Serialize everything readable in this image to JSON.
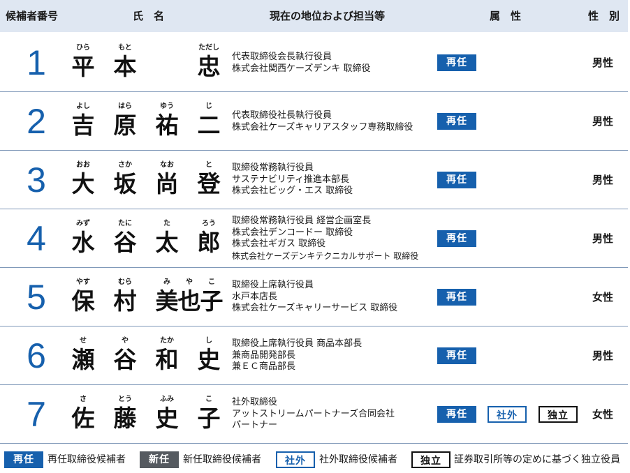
{
  "header": {
    "number": "候補者番号",
    "name": "氏　名",
    "position": "現在の地位および担当等",
    "attribute": "属　性",
    "gender": "性　別"
  },
  "candidates": [
    {
      "number": "1",
      "name": [
        {
          "ruby": "ひら",
          "kanji": "平"
        },
        {
          "ruby": "もと",
          "kanji": "本"
        },
        {
          "ruby": "ただし",
          "kanji": "忠"
        }
      ],
      "position": [
        "代表取締役会長執行役員",
        "株式会社関西ケーズデンキ 取締役"
      ],
      "badges": [
        "再任"
      ],
      "gender": "男性"
    },
    {
      "number": "2",
      "name": [
        {
          "ruby": "よし",
          "kanji": "吉"
        },
        {
          "ruby": "はら",
          "kanji": "原"
        },
        {
          "ruby": "ゆう",
          "kanji": "祐"
        },
        {
          "ruby": "じ",
          "kanji": "二"
        }
      ],
      "position": [
        "代表取締役社長執行役員",
        "株式会社ケーズキャリアスタッフ専務取締役"
      ],
      "badges": [
        "再任"
      ],
      "gender": "男性"
    },
    {
      "number": "3",
      "name": [
        {
          "ruby": "おお",
          "kanji": "大"
        },
        {
          "ruby": "さか",
          "kanji": "坂"
        },
        {
          "ruby": "なお",
          "kanji": "尚"
        },
        {
          "ruby": "と",
          "kanji": "登"
        }
      ],
      "position": [
        "取締役常務執行役員",
        "サステナビリティ推進本部長",
        "株式会社ビッグ・エス 取締役"
      ],
      "badges": [
        "再任"
      ],
      "gender": "男性"
    },
    {
      "number": "4",
      "name": [
        {
          "ruby": "みず",
          "kanji": "水"
        },
        {
          "ruby": "たに",
          "kanji": "谷"
        },
        {
          "ruby": "た",
          "kanji": "太"
        },
        {
          "ruby": "ろう",
          "kanji": "郎"
        }
      ],
      "position": [
        "取締役常務執行役員 経営企画室長",
        "株式会社デンコードー 取締役",
        "株式会社ギガス 取締役",
        "株式会社ケーズデンキテクニカルサポート 取締役"
      ],
      "badges": [
        "再任"
      ],
      "gender": "男性"
    },
    {
      "number": "5",
      "name": [
        {
          "ruby": "やす",
          "kanji": "保"
        },
        {
          "ruby": "むら",
          "kanji": "村"
        },
        {
          "ruby": "み",
          "kanji": "美"
        },
        {
          "ruby": "や",
          "kanji": "也"
        },
        {
          "ruby": "こ",
          "kanji": "子"
        }
      ],
      "position": [
        "取締役上席執行役員",
        "水戸本店長",
        "株式会社ケーズキャリーサービス 取締役"
      ],
      "badges": [
        "再任"
      ],
      "gender": "女性"
    },
    {
      "number": "6",
      "name": [
        {
          "ruby": "せ",
          "kanji": "瀬"
        },
        {
          "ruby": "や",
          "kanji": "谷"
        },
        {
          "ruby": "たか",
          "kanji": "和"
        },
        {
          "ruby": "し",
          "kanji": "史"
        }
      ],
      "position": [
        "取締役上席執行役員 商品本部長",
        "兼商品開発部長",
        "兼ＥＣ商品部長"
      ],
      "badges": [
        "再任"
      ],
      "gender": "男性"
    },
    {
      "number": "7",
      "name": [
        {
          "ruby": "さ",
          "kanji": "佐"
        },
        {
          "ruby": "とう",
          "kanji": "藤"
        },
        {
          "ruby": "ふみ",
          "kanji": "史"
        },
        {
          "ruby": "こ",
          "kanji": "子"
        }
      ],
      "position": [
        "社外取締役",
        "アットストリームパートナーズ合同会社",
        "パートナー"
      ],
      "badges": [
        "再任",
        "社外",
        "独立"
      ],
      "gender": "女性"
    }
  ],
  "legend": [
    {
      "badge": "再任",
      "text": "再任取締役候補者"
    },
    {
      "badge": "新任",
      "text": "新任取締役候補者"
    },
    {
      "badge": "社外",
      "text": "社外取締役候補者"
    },
    {
      "badge": "独立",
      "text": "証券取引所等の定めに基づく独立役員"
    }
  ],
  "colors": {
    "accent": "#1660ad",
    "header_bg": "#dfe7f2",
    "shinin": "#555a60"
  }
}
